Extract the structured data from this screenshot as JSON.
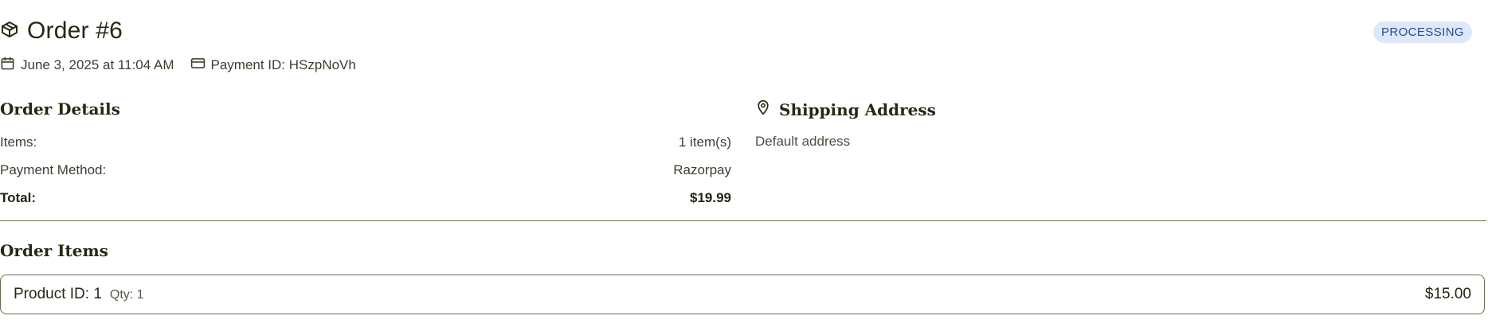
{
  "order": {
    "title": "Order #6",
    "status": "PROCESSING",
    "date": "June 3, 2025 at 11:04 AM",
    "payment_id": "Payment ID: HSzpNoVh"
  },
  "order_details": {
    "title": "Order Details",
    "rows": [
      {
        "label": "Items:",
        "value": "1 item(s)"
      },
      {
        "label": "Payment Method:",
        "value": "Razorpay"
      },
      {
        "label": "Total:",
        "value": "$19.99"
      }
    ]
  },
  "shipping": {
    "title": "Shipping Address",
    "address": "Default address"
  },
  "order_items": {
    "title": "Order Items",
    "items": [
      {
        "name": "Product ID: 1",
        "qty": "Qty: 1",
        "price": "$15.00"
      }
    ]
  },
  "icons": {
    "title": "package-icon",
    "date": "calendar-icon",
    "payment": "credit-card-icon",
    "shipping": "map-pin-icon"
  },
  "colors": {
    "text_dark": "#232a14",
    "badge_bg": "#dde8fb",
    "badge_text": "#2c4b8c",
    "border": "#6b6a4f"
  }
}
